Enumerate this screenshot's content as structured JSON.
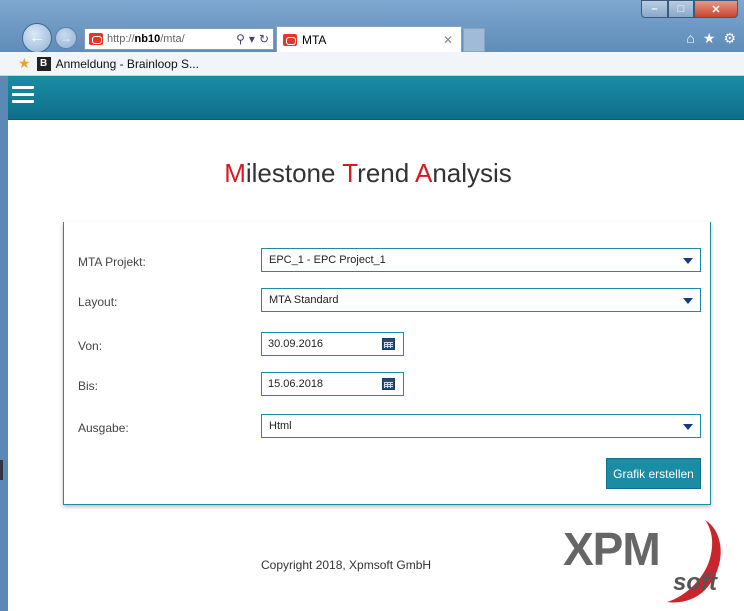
{
  "browser": {
    "url_prefix": "http://",
    "url_host": "nb10",
    "url_path": "/mta/",
    "tab_title": "MTA",
    "favorites": [
      {
        "label": "Anmeldung - Brainloop S..."
      }
    ]
  },
  "app": {
    "title_parts": [
      {
        "initial": "M",
        "rest": "ilestone "
      },
      {
        "initial": "T",
        "rest": "rend "
      },
      {
        "initial": "A",
        "rest": "nalysis"
      }
    ],
    "accent_color": "#d71920",
    "header_color": "#1a8ca6"
  },
  "form": {
    "project": {
      "label": "MTA Projekt:",
      "value": "EPC_1 - EPC Project_1"
    },
    "layout": {
      "label": "Layout:",
      "value": "MTA Standard"
    },
    "from": {
      "label": "Von:",
      "value": "30.09.2016"
    },
    "to": {
      "label": "Bis:",
      "value": "15.06.2018"
    },
    "output": {
      "label": "Ausgabe:",
      "value": "Html"
    },
    "submit_label": "Grafik erstellen"
  },
  "footer": {
    "copyright": "Copyright 2018, Xpmsoft GmbH",
    "logo_main": "XPM",
    "logo_sub": "soft"
  }
}
